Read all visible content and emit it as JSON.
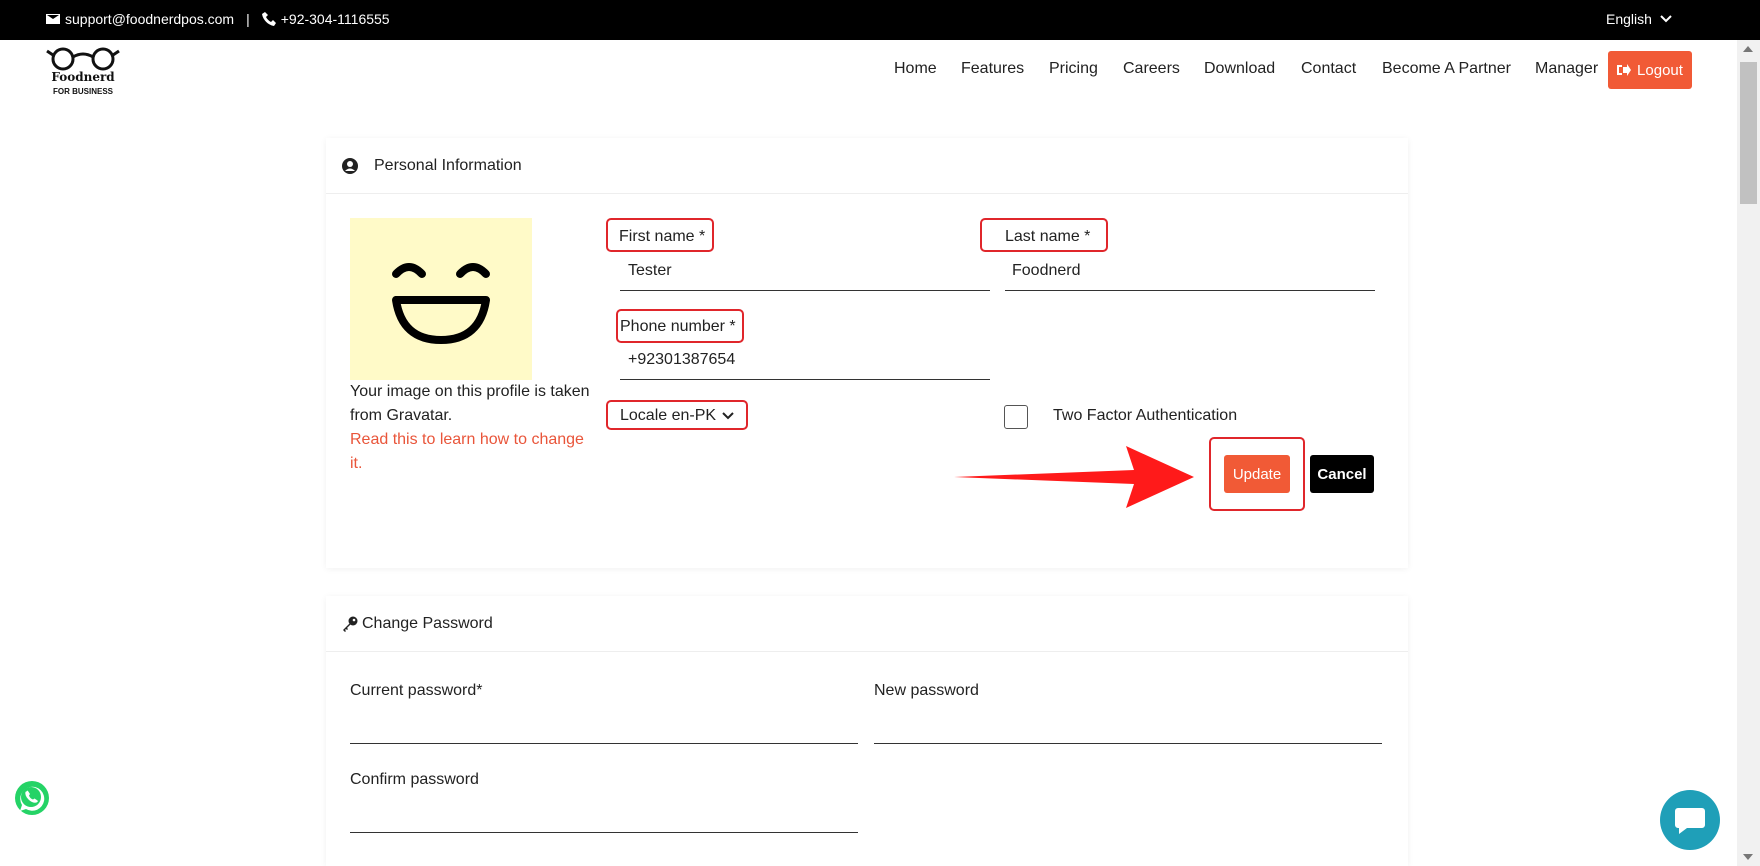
{
  "topbar": {
    "email": "support@foodnerdpos.com",
    "separator": "|",
    "phone": "+92-304-1116555",
    "language": "English"
  },
  "header": {
    "logo_brand": "Foodnerd",
    "logo_sub": "FOR BUSINESS",
    "nav": [
      "Home",
      "Features",
      "Pricing",
      "Careers",
      "Download",
      "Contact",
      "Become A Partner",
      "Manager"
    ],
    "logout_label": "Logout"
  },
  "personal_info": {
    "title": "Personal Information",
    "avatar_caption": "Your image on this profile is taken from Gravatar.",
    "avatar_link": "Read this to learn how to change it.",
    "first_name_label": "First name *",
    "first_name_value": "Tester",
    "last_name_label": "Last name *",
    "last_name_value": "Foodnerd",
    "phone_label": "Phone number *",
    "phone_value": "+92301387654",
    "locale_label": "Locale en-PK",
    "two_factor_label": "Two Factor Authentication",
    "two_factor_checked": false,
    "update_label": "Update",
    "cancel_label": "Cancel"
  },
  "change_password": {
    "title": "Change Password",
    "current_label": "Current password*",
    "new_label": "New password",
    "confirm_label": "Confirm password"
  },
  "colors": {
    "accent": "#f15a36",
    "highlight": "#e0262b",
    "arrow": "#ff1a1a",
    "chat": "#1f9fb8",
    "whatsapp": "#25d366",
    "avatar_bg": "#fffac8"
  },
  "icons": [
    "envelope-icon",
    "phone-icon",
    "chevron-down-icon",
    "logout-icon",
    "user-circle-icon",
    "key-icon",
    "whatsapp-icon",
    "chat-icon",
    "smiley-icon"
  ]
}
